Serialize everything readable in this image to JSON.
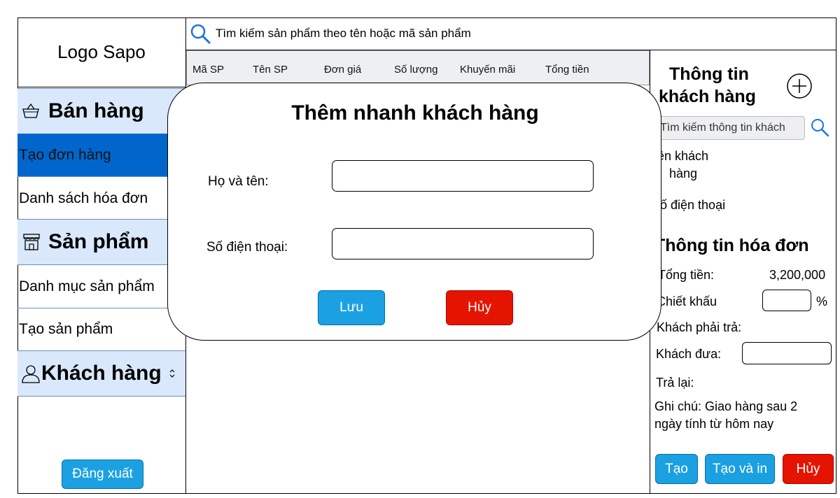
{
  "sidebar": {
    "logo": "Logo Sapo",
    "groups": {
      "sales": {
        "label": "Bán hàng",
        "icon": "shopping-basket-icon"
      },
      "products": {
        "label": "Sản phẩm",
        "icon": "store-icon"
      },
      "customers": {
        "label": "Khách hàng",
        "icon": "user-icon",
        "toggle_icon": "chevron-up-down-icon"
      }
    },
    "items": {
      "create_order": "Tạo đơn hàng",
      "invoice_list": "Danh sách hóa đơn",
      "product_catalog": "Danh mục sản phẩm",
      "create_product": "Tạo sản phẩm"
    },
    "logout_label": "Đăng xuất"
  },
  "search": {
    "text": "Tìm kiếm sản phẩm theo tên hoặc mã sản phẩm",
    "icon": "search-icon"
  },
  "table": {
    "columns": [
      "Mã SP",
      "Tên SP",
      "Đơn giá",
      "Số lượng",
      "Khuyến mãi",
      "Tổng tiền"
    ]
  },
  "customer_panel": {
    "title_line1": "Thông tin",
    "title_line2": "khách hàng",
    "add_icon": "add-circle-icon",
    "search_placeholder": "Tìm kiếm thông tin khách",
    "name_label_line1": "ên khách",
    "name_label_line2": "hàng",
    "phone_label": "ố điện thoại"
  },
  "invoice_panel": {
    "title": "Thông tin hóa đơn",
    "total_label": "Tổng tiền:",
    "total_value": "3,200,000",
    "discount_label": "Chiết khấu",
    "percent_sign": "%",
    "payable_label": "Khách phải trả:",
    "paid_label": "Khách đưa:",
    "change_label": "Trả lại:",
    "note_line1": "Ghi chú: Giao hàng sau 2",
    "note_line2": "ngày tính từ hôm nay",
    "buttons": {
      "create": "Tạo",
      "create_print": "Tạo và in",
      "cancel": "Hủy"
    }
  },
  "modal": {
    "title": "Thêm nhanh khách hàng",
    "name_label": "Họ và tên:",
    "phone_label": "Số điện thoại:",
    "save_label": "Lưu",
    "cancel_label": "Hủy"
  },
  "colors": {
    "accent_blue": "#1ba1e2",
    "active_blue": "#0066cc",
    "group_bg": "#dae8fc",
    "danger_red": "#e51400"
  }
}
